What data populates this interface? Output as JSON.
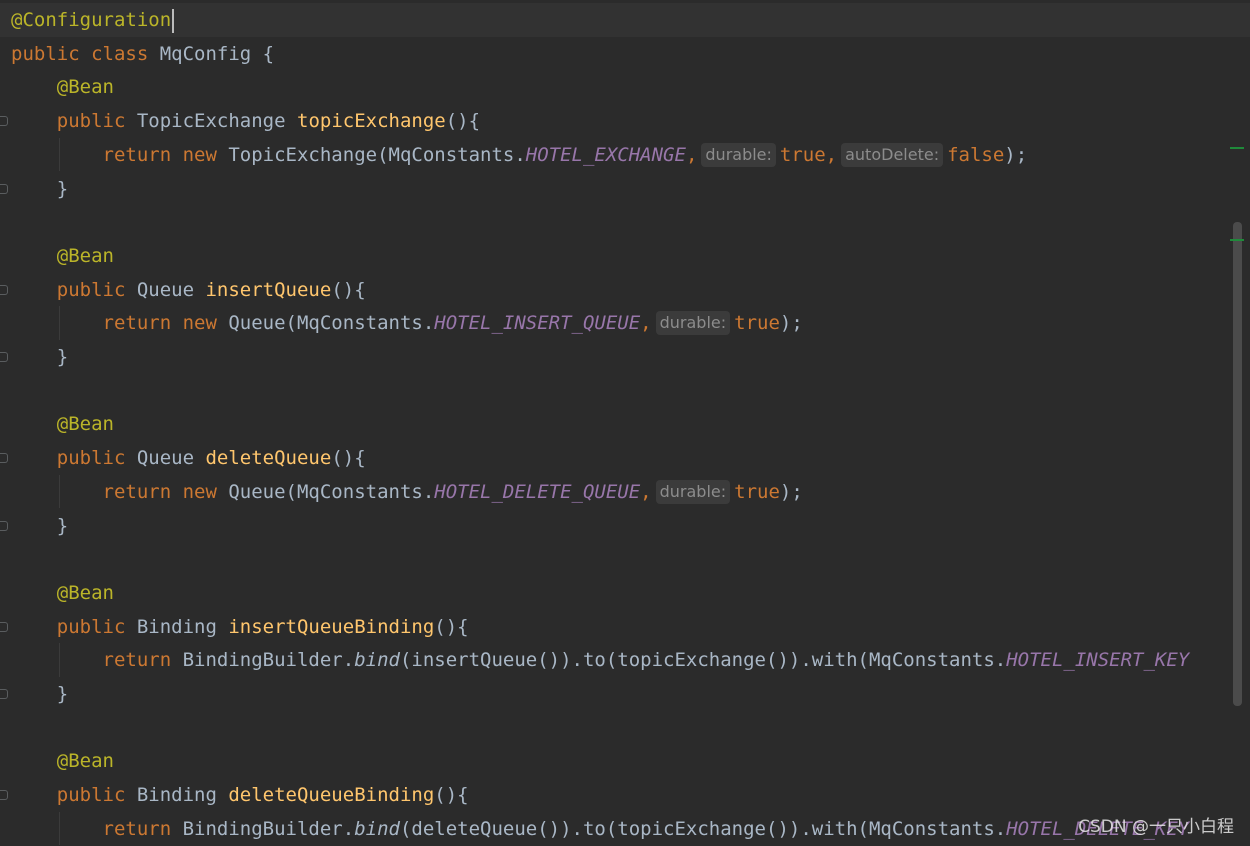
{
  "editor": {
    "lines": [
      {
        "id": "l1",
        "current": true,
        "parts": [
          {
            "c": "ann",
            "t": "@Configuration"
          }
        ]
      },
      {
        "id": "l2",
        "parts": [
          {
            "c": "kw",
            "t": "public class "
          },
          {
            "t": "MqConfig {"
          }
        ]
      },
      {
        "id": "l3",
        "parts": [
          {
            "t": "    "
          },
          {
            "c": "ann",
            "t": "@Bean"
          }
        ]
      },
      {
        "id": "l4",
        "parts": [
          {
            "t": "    "
          },
          {
            "c": "kw",
            "t": "public "
          },
          {
            "t": "TopicExchange "
          },
          {
            "c": "fn",
            "t": "topicExchange"
          },
          {
            "t": "(){"
          }
        ]
      },
      {
        "id": "l5",
        "parts": [
          {
            "t": "        "
          },
          {
            "c": "kw",
            "t": "return new "
          },
          {
            "t": "TopicExchange(MqConstants."
          },
          {
            "c": "cst",
            "t": "HOTEL_EXCHANGE"
          },
          {
            "c": "kw",
            "t": ","
          },
          {
            "c": "hint",
            "t": "durable:"
          },
          {
            "c": "kw",
            "t": "true,"
          },
          {
            "c": "hint",
            "t": "autoDelete:"
          },
          {
            "c": "kw",
            "t": "false"
          },
          {
            "t": ");"
          }
        ]
      },
      {
        "id": "l6",
        "parts": [
          {
            "t": "    }"
          }
        ]
      },
      {
        "id": "l7",
        "parts": [
          {
            "t": ""
          }
        ]
      },
      {
        "id": "l8",
        "parts": [
          {
            "t": "    "
          },
          {
            "c": "ann",
            "t": "@Bean"
          }
        ]
      },
      {
        "id": "l9",
        "parts": [
          {
            "t": "    "
          },
          {
            "c": "kw",
            "t": "public "
          },
          {
            "t": "Queue "
          },
          {
            "c": "fn",
            "t": "insertQueue"
          },
          {
            "t": "(){"
          }
        ]
      },
      {
        "id": "l10",
        "parts": [
          {
            "t": "        "
          },
          {
            "c": "kw",
            "t": "return new "
          },
          {
            "t": "Queue(MqConstants."
          },
          {
            "c": "cst",
            "t": "HOTEL_INSERT_QUEUE"
          },
          {
            "c": "kw",
            "t": ","
          },
          {
            "c": "hint",
            "t": "durable:"
          },
          {
            "c": "kw",
            "t": "true"
          },
          {
            "t": ");"
          }
        ]
      },
      {
        "id": "l11",
        "parts": [
          {
            "t": "    }"
          }
        ]
      },
      {
        "id": "l12",
        "parts": [
          {
            "t": ""
          }
        ]
      },
      {
        "id": "l13",
        "parts": [
          {
            "t": "    "
          },
          {
            "c": "ann",
            "t": "@Bean"
          }
        ]
      },
      {
        "id": "l14",
        "parts": [
          {
            "t": "    "
          },
          {
            "c": "kw",
            "t": "public "
          },
          {
            "t": "Queue "
          },
          {
            "c": "fn",
            "t": "deleteQueue"
          },
          {
            "t": "(){"
          }
        ]
      },
      {
        "id": "l15",
        "parts": [
          {
            "t": "        "
          },
          {
            "c": "kw",
            "t": "return new "
          },
          {
            "t": "Queue(MqConstants."
          },
          {
            "c": "cst",
            "t": "HOTEL_DELETE_QUEUE"
          },
          {
            "c": "kw",
            "t": ","
          },
          {
            "c": "hint",
            "t": "durable:"
          },
          {
            "c": "kw",
            "t": "true"
          },
          {
            "t": ");"
          }
        ]
      },
      {
        "id": "l16",
        "parts": [
          {
            "t": "    }"
          }
        ]
      },
      {
        "id": "l17",
        "parts": [
          {
            "t": ""
          }
        ]
      },
      {
        "id": "l18",
        "parts": [
          {
            "t": "    "
          },
          {
            "c": "ann",
            "t": "@Bean"
          }
        ]
      },
      {
        "id": "l19",
        "parts": [
          {
            "t": "    "
          },
          {
            "c": "kw",
            "t": "public "
          },
          {
            "t": "Binding "
          },
          {
            "c": "fn",
            "t": "insertQueueBinding"
          },
          {
            "t": "(){"
          }
        ]
      },
      {
        "id": "l20",
        "parts": [
          {
            "t": "        "
          },
          {
            "c": "kw",
            "t": "return "
          },
          {
            "t": "BindingBuilder."
          },
          {
            "c": "sm",
            "t": "bind"
          },
          {
            "t": "(insertQueue()).to(topicExchange()).with(MqConstants."
          },
          {
            "c": "cst",
            "t": "HOTEL_INSERT_KEY"
          }
        ]
      },
      {
        "id": "l21",
        "parts": [
          {
            "t": "    }"
          }
        ]
      },
      {
        "id": "l22",
        "parts": [
          {
            "t": ""
          }
        ]
      },
      {
        "id": "l23",
        "parts": [
          {
            "t": "    "
          },
          {
            "c": "ann",
            "t": "@Bean"
          }
        ]
      },
      {
        "id": "l24",
        "parts": [
          {
            "t": "    "
          },
          {
            "c": "kw",
            "t": "public "
          },
          {
            "t": "Binding "
          },
          {
            "c": "fn",
            "t": "deleteQueueBinding"
          },
          {
            "t": "(){"
          }
        ]
      },
      {
        "id": "l25",
        "parts": [
          {
            "t": "        "
          },
          {
            "c": "kw",
            "t": "return "
          },
          {
            "t": "BindingBuilder."
          },
          {
            "c": "sm",
            "t": "bind"
          },
          {
            "t": "(deleteQueue()).to(topicExchange()).with(MqConstants."
          },
          {
            "c": "cst",
            "t": "HOTEL_DELETE_KEY"
          }
        ]
      }
    ]
  },
  "watermark": "CSDN @一只小白程",
  "colors": {
    "background": "#2b2b2b",
    "keyword": "#cc7832",
    "annotation": "#bbb529",
    "method": "#ffc66d",
    "constant": "#9876aa",
    "text": "#a9b7c6"
  }
}
